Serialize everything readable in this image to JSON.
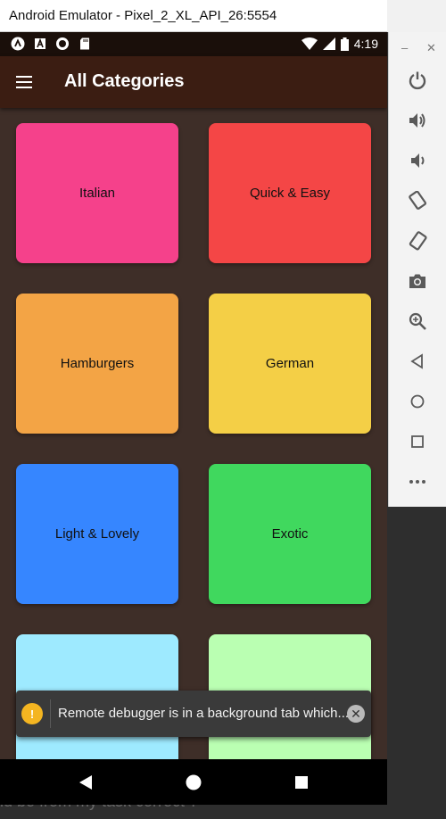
{
  "window": {
    "title": "Android Emulator - Pixel_2_XL_API_26:5554"
  },
  "status_bar": {
    "time": "4:19",
    "icons_left": [
      "launcher-a-icon",
      "a-badge-icon",
      "circle-icon",
      "sd-card-icon"
    ],
    "icons_right": [
      "wifi-icon",
      "signal-icon",
      "battery-icon"
    ]
  },
  "app_bar": {
    "title": "All Categories",
    "menu_icon": "hamburger-menu-icon"
  },
  "categories": [
    {
      "label": "Italian",
      "color": "#f5418b"
    },
    {
      "label": "Quick & Easy",
      "color": "#f44646"
    },
    {
      "label": "Hamburgers",
      "color": "#f3a445"
    },
    {
      "label": "German",
      "color": "#f4cf46"
    },
    {
      "label": "Light & Lovely",
      "color": "#3686ff"
    },
    {
      "label": "Exotic",
      "color": "#40d85e"
    },
    {
      "label": "",
      "color": "#9eeaff"
    },
    {
      "label": "",
      "color": "#baffb2"
    }
  ],
  "snackbar": {
    "text": "Remote debugger is in a background tab which...",
    "icon": "warning-icon",
    "close_icon": "close-icon"
  },
  "nav_bar": {
    "buttons": [
      "back-icon",
      "home-icon",
      "recents-icon"
    ]
  },
  "emulator_toolbar": {
    "window_controls": [
      "minimize-icon",
      "close-icon"
    ],
    "buttons": [
      "power-icon",
      "volume-up-icon",
      "volume-down-icon",
      "rotate-left-icon",
      "rotate-right-icon",
      "camera-icon",
      "zoom-icon",
      "back-icon",
      "home-icon",
      "overview-icon",
      "more-icon"
    ]
  },
  "background": {
    "text": "ld be from my task correct ?"
  },
  "colors": {
    "app_bar": "#3b1d12",
    "status_bar": "#1a0f0a",
    "body": "#3e2e28"
  }
}
